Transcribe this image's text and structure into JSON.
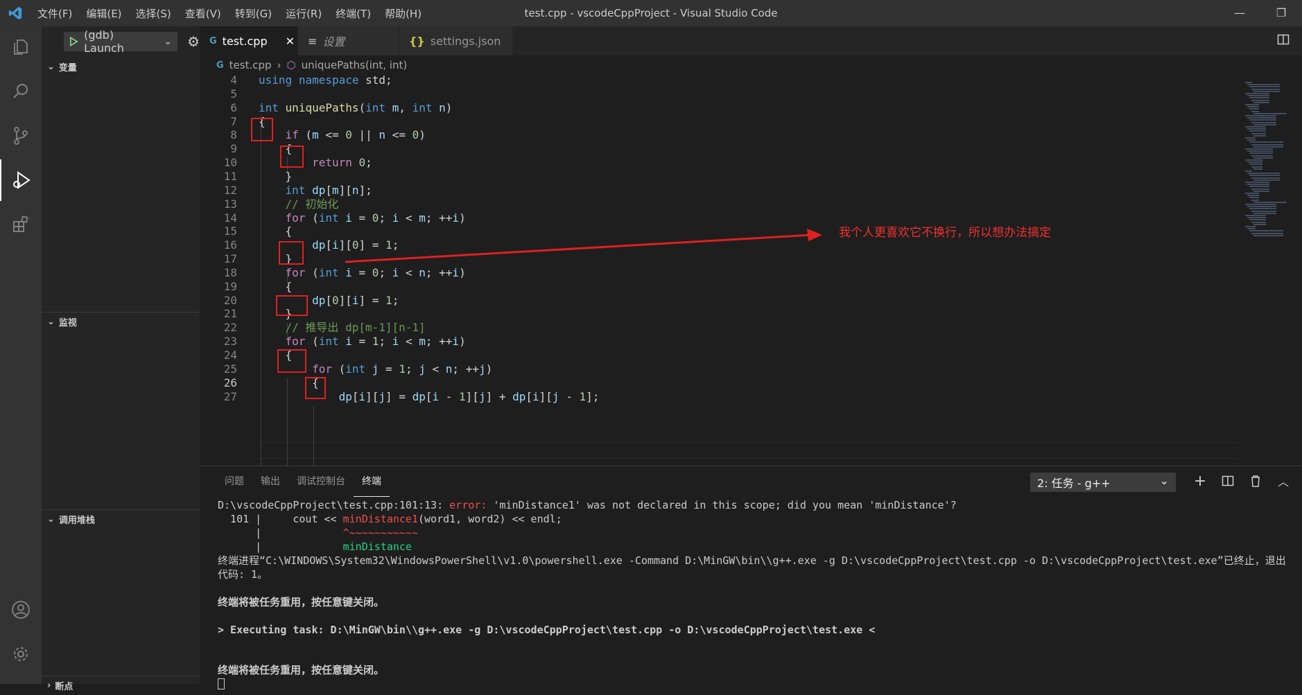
{
  "titlebar": {
    "menu": [
      "文件(F)",
      "编辑(E)",
      "选择(S)",
      "查看(V)",
      "转到(G)",
      "运行(R)",
      "终端(T)",
      "帮助(H)"
    ],
    "title": "test.cpp - vscodeCppProject - Visual Studio Code",
    "minimize": "—",
    "restore": "❐"
  },
  "activity_bar": [
    "explorer-icon",
    "search-icon",
    "source-control-icon",
    "run-debug-icon",
    "extensions-icon",
    "account-icon",
    "settings-gear-icon"
  ],
  "sidebar": {
    "launch_config": "(gdb) Launch",
    "sections": [
      "变量",
      "监视",
      "调用堆栈",
      "断点"
    ]
  },
  "tabs": [
    {
      "label": "test.cpp",
      "icon": "C++",
      "active": true
    },
    {
      "label": "设置",
      "icon": "≡",
      "active": false
    },
    {
      "label": "settings.json",
      "icon": "{}",
      "active": false
    }
  ],
  "breadcrumb": {
    "file": "test.cpp",
    "symbol": "uniquePaths(int, int)"
  },
  "code_lines": [
    {
      "n": "4",
      "html": "<span class=\"kw\">using</span> <span class=\"kw\">namespace</span> std;"
    },
    {
      "n": "5",
      "html": ""
    },
    {
      "n": "6",
      "html": "<span class=\"kw\">int</span> <span class=\"fn\">uniquePaths</span>(<span class=\"kw\">int</span> <span class=\"var\">m</span>, <span class=\"kw\">int</span> <span class=\"var\">n</span>)"
    },
    {
      "n": "7",
      "html": "{"
    },
    {
      "n": "8",
      "html": "    <span class=\"ctl\">if</span> (<span class=\"var\">m</span> &lt;= <span class=\"num\">0</span> || <span class=\"var\">n</span> &lt;= <span class=\"num\">0</span>)"
    },
    {
      "n": "9",
      "html": "    {"
    },
    {
      "n": "10",
      "html": "        <span class=\"ctl\">return</span> <span class=\"num\">0</span>;"
    },
    {
      "n": "11",
      "html": "    }"
    },
    {
      "n": "12",
      "html": "    <span class=\"kw\">int</span> <span class=\"var\">dp</span>[<span class=\"var\">m</span>][<span class=\"var\">n</span>];"
    },
    {
      "n": "13",
      "html": "    <span class=\"cm\">// 初始化</span>"
    },
    {
      "n": "14",
      "html": "    <span class=\"ctl\">for</span> (<span class=\"kw\">int</span> <span class=\"var\">i</span> = <span class=\"num\">0</span>; <span class=\"var\">i</span> &lt; <span class=\"var\">m</span>; ++<span class=\"var\">i</span>)"
    },
    {
      "n": "15",
      "html": "    {"
    },
    {
      "n": "16",
      "html": "        <span class=\"var\">dp</span>[<span class=\"var\">i</span>][<span class=\"num\">0</span>] = <span class=\"num\">1</span>;"
    },
    {
      "n": "17",
      "html": "    }"
    },
    {
      "n": "18",
      "html": "    <span class=\"ctl\">for</span> (<span class=\"kw\">int</span> <span class=\"var\">i</span> = <span class=\"num\">0</span>; <span class=\"var\">i</span> &lt; <span class=\"var\">n</span>; ++<span class=\"var\">i</span>)"
    },
    {
      "n": "19",
      "html": "    {"
    },
    {
      "n": "20",
      "html": "        <span class=\"var\">dp</span>[<span class=\"num\">0</span>][<span class=\"var\">i</span>] = <span class=\"num\">1</span>;"
    },
    {
      "n": "21",
      "html": "    }"
    },
    {
      "n": "22",
      "html": "    <span class=\"cm\">// 推导出 dp[m-1][n-1]</span>"
    },
    {
      "n": "23",
      "html": "    <span class=\"ctl\">for</span> (<span class=\"kw\">int</span> <span class=\"var\">i</span> = <span class=\"num\">1</span>; <span class=\"var\">i</span> &lt; <span class=\"var\">m</span>; ++<span class=\"var\">i</span>)"
    },
    {
      "n": "24",
      "html": "    {"
    },
    {
      "n": "25",
      "html": "        <span class=\"ctl\">for</span> (<span class=\"kw\">int</span> <span class=\"var\">j</span> = <span class=\"num\">1</span>; <span class=\"var\">j</span> &lt; <span class=\"var\">n</span>; ++<span class=\"var\">j</span>)"
    },
    {
      "n": "26",
      "html": "        {"
    },
    {
      "n": "27",
      "html": "            <span class=\"var\">dp</span>[<span class=\"var\">i</span>][<span class=\"var\">j</span>] = <span class=\"var\">dp</span>[<span class=\"var\">i</span> - <span class=\"num\">1</span>][<span class=\"var\">j</span>] + <span class=\"var\">dp</span>[<span class=\"var\">i</span>][<span class=\"var\">j</span> - <span class=\"num\">1</span>];"
    }
  ],
  "annotation": "我个人更喜欢它不换行，所以想办法搞定",
  "panel": {
    "tabs": [
      "问题",
      "输出",
      "调试控制台",
      "终端"
    ],
    "active_tab": "终端",
    "terminal_select": "2: 任务 - g++",
    "terminal_lines": [
      "D:\\vscodeCppProject\\test.cpp:101:13: <span class=\"err\">error: </span>'minDistance1' was not declared in this scope; did you mean 'minDistance'?",
      "  101 |     cout << <span class=\"err\">minDistance1</span>(word1, word2) << endl;",
      "      |             <span class=\"err\">^~~~~~~~~~~~</span>",
      "      |             <span class=\"grn\">minDistance</span>",
      "终端进程“C:\\WINDOWS\\System32\\WindowsPowerShell\\v1.0\\powershell.exe -Command D:\\MinGW\\bin\\\\g++.exe -g D:\\vscodeCppProject\\test.cpp -o D:\\vscodeCppProject\\test.exe”已终止，退出",
      "代码: 1。",
      "",
      "<span class=\"bold\">终端将被任务重用，按任意键关闭。</span>",
      "",
      "<span class=\"bold\">&gt; Executing task: D:\\MinGW\\bin\\\\g++.exe -g D:\\vscodeCppProject\\test.cpp -o D:\\vscodeCppProject\\test.exe &lt;</span>",
      "",
      "",
      "<span class=\"bold\">终端将被任务重用，按任意键关闭。</span>"
    ]
  }
}
